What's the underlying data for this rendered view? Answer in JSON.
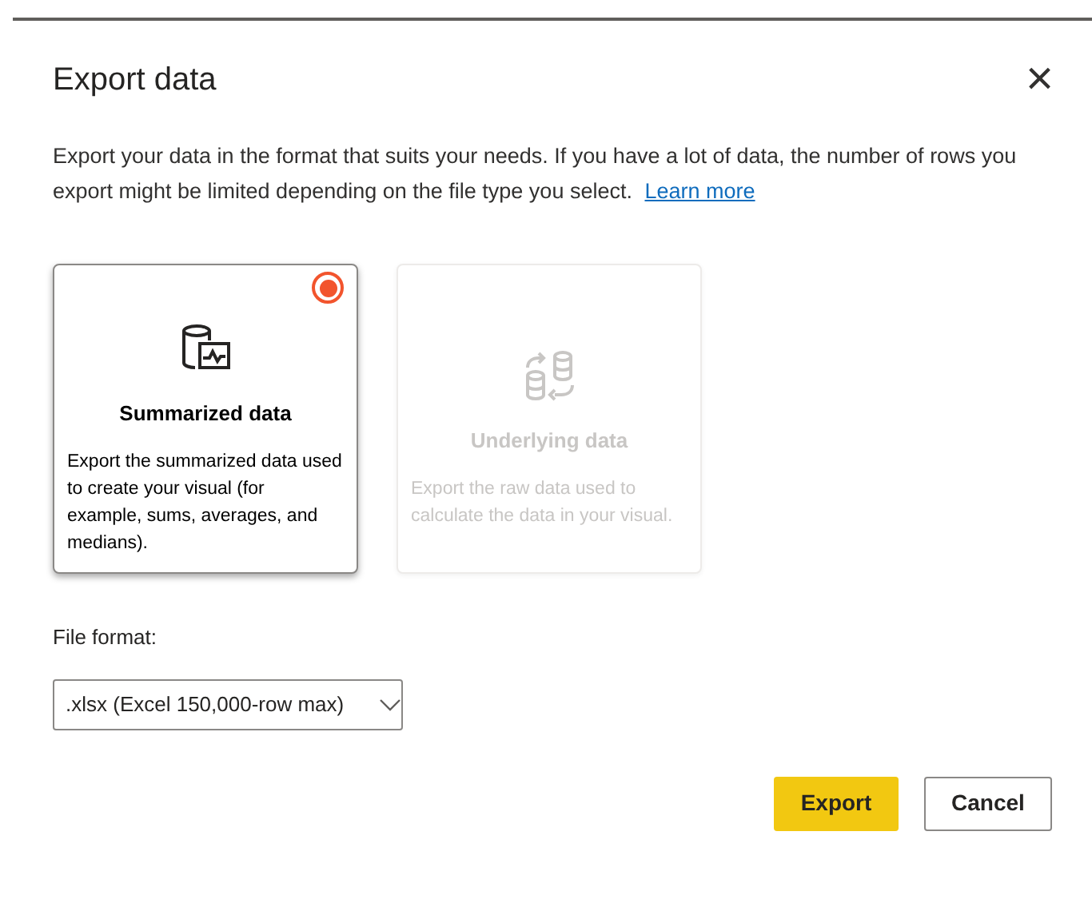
{
  "dialog": {
    "title": "Export data",
    "close": "×",
    "description": "Export your data in the format that suits your needs. If you have a lot of data, the number of rows you export might be limited depending on the file type you select.",
    "learn_more": "Learn more",
    "options": [
      {
        "kind": "summarized",
        "title": "Summarized data",
        "description": "Export the summarized data used to create your visual (for example, sums, averages, and medians).",
        "selected": true,
        "disabled": false
      },
      {
        "kind": "underlying",
        "title": "Underlying data",
        "description": "Export the raw data used to calculate the data in your visual.",
        "selected": false,
        "disabled": true
      }
    ],
    "file_format": {
      "label": "File format:",
      "value": ".xlsx (Excel 150,000-row max)"
    },
    "buttons": [
      {
        "kind": "primary",
        "label": "Export"
      },
      {
        "kind": "secondary",
        "label": "Cancel"
      }
    ]
  }
}
